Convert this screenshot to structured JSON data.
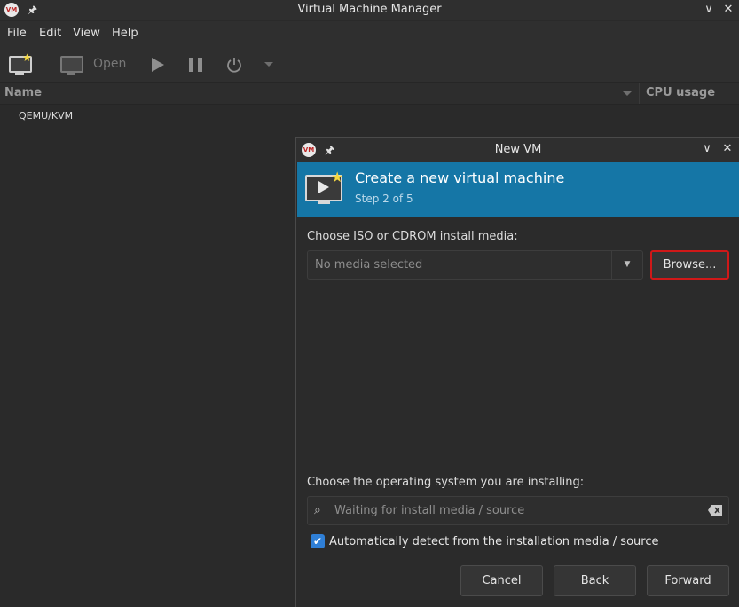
{
  "main_window": {
    "title": "Virtual Machine Manager",
    "app_logo_text": "VM",
    "menu": [
      "File",
      "Edit",
      "View",
      "Help"
    ],
    "toolbar": {
      "open_label": "Open"
    },
    "columns": {
      "name": "Name",
      "cpu_usage": "CPU usage"
    },
    "connections": [
      {
        "label": "QEMU/KVM"
      }
    ]
  },
  "dialog": {
    "title": "New VM",
    "banner": {
      "title": "Create a new virtual machine",
      "step": "Step 2 of 5"
    },
    "media": {
      "label": "Choose ISO or CDROM install media:",
      "value": "No media selected",
      "browse_label": "Browse..."
    },
    "os": {
      "label": "Choose the operating system you are installing:",
      "placeholder": "Waiting for install media / source",
      "auto_detect_label": "Automatically detect from the installation media / source",
      "auto_detect_checked": true
    },
    "buttons": {
      "cancel": "Cancel",
      "back": "Back",
      "forward": "Forward"
    }
  },
  "colors": {
    "banner": "#1576a6",
    "browse_highlight": "#d01818",
    "checkbox": "#2f7fd6"
  }
}
